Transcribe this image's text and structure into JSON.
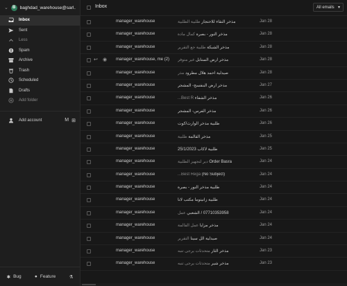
{
  "account": {
    "name": "baghdad_warehouse@sarl...",
    "initial": "B"
  },
  "nav": [
    {
      "label": "Inbox",
      "icon": "inbox-icon",
      "active": true
    },
    {
      "label": "Sent",
      "icon": "send-icon"
    },
    {
      "label": "Less",
      "icon": "chevron-up-icon",
      "dim": true
    },
    {
      "label": "Spam",
      "icon": "spam-icon"
    },
    {
      "label": "Archive",
      "icon": "archive-icon"
    },
    {
      "label": "Trash",
      "icon": "trash-icon"
    },
    {
      "label": "Scheduled",
      "icon": "clock-icon"
    },
    {
      "label": "Drafts",
      "icon": "drafts-icon"
    },
    {
      "label": "Add folder",
      "icon": "plus-icon",
      "dim": true
    }
  ],
  "add_account": {
    "label": "Add account"
  },
  "footer": {
    "bug": "Bug",
    "feature": "Feature"
  },
  "header": {
    "title": "Inbox",
    "filter": "All emails"
  },
  "emails": [
    {
      "sender": "manager_warehouse",
      "subject": "مذخر النقاء للاحتجار",
      "preview": "طلبية الطلبية",
      "date": "Jan 28"
    },
    {
      "sender": "manager_warehouse",
      "subject": "مذخر النور - بصرة",
      "preview": "كمال مادة",
      "date": "Jan 28"
    },
    {
      "sender": "manager_warehouse",
      "subject": "مذخر الشبكة",
      "preview": "طلبية جع التقرير",
      "date": "Jan 28"
    },
    {
      "sender": "manager_warehouse, me (2)",
      "subject": "مذخر ارض الستابل",
      "preview": "غير متوفر",
      "date": "Jan 28"
    },
    {
      "sender": "manager_warehouse",
      "subject": "صيدلية احمد هلال مطرود",
      "preview": "مذر",
      "date": "Jan 28"
    },
    {
      "sender": "manager_warehouse",
      "subject": "مذخر ارض البنفسج- المشجر",
      "preview": "",
      "date": "Jan 27"
    },
    {
      "sender": "manager_warehouse",
      "subject": "مذخر الشفاء",
      "preview": "Best R...",
      "date": "Jan 26"
    },
    {
      "sender": "manager_warehouse",
      "subject": "مذخر الفرس- المشجر",
      "preview": "",
      "date": "Jan 26"
    },
    {
      "sender": "manager_warehouse",
      "subject": "طلبية مذخر الوارث/كوت",
      "preview": "",
      "date": "Jan 26"
    },
    {
      "sender": "manager_warehouse",
      "subject": "مذخر القالمة",
      "preview": "طلبية",
      "date": "Jan 25"
    },
    {
      "sender": "manager_warehouse",
      "subject": "طلبية لاكاب 25/1/2023",
      "preview": "",
      "date": "Jan 25"
    },
    {
      "sender": "manager_warehouse",
      "subject": "Order Basra",
      "preview": "دير لتجهيز الطلبية",
      "date": "Jan 24"
    },
    {
      "sender": "manager_warehouse",
      "subject": "(No Subject)",
      "preview": "Best Rega...",
      "date": "Jan 24"
    },
    {
      "sender": "manager_warehouse",
      "subject": "طلبية مذخر النور - بصرة",
      "preview": "",
      "date": "Jan 24"
    },
    {
      "sender": "manager_warehouse",
      "subject": "طلبية زانيتوما مكتب لانا",
      "preview": "",
      "date": "Jan 24"
    },
    {
      "sender": "manager_warehouse",
      "subject": "07710353958 / الشعبي",
      "preview": "عمل",
      "date": "Jan 24"
    },
    {
      "sender": "manager_warehouse",
      "subject": "مذخر مزايا",
      "preview": "عمل القالمة",
      "date": "Jan 24"
    },
    {
      "sender": "manager_warehouse",
      "subject": "صيدلية الل سينا",
      "preview": "التقرير",
      "date": "Jan 24"
    },
    {
      "sender": "manager_warehouse",
      "subject": "مذخر الثار",
      "preview": "متحدثات يرجى تنبه",
      "date": "Jan 23"
    },
    {
      "sender": "manager_warehouse",
      "subject": "مذخر شير",
      "preview": "متحدثات يرجى تنبه",
      "date": "Jan 23"
    }
  ]
}
